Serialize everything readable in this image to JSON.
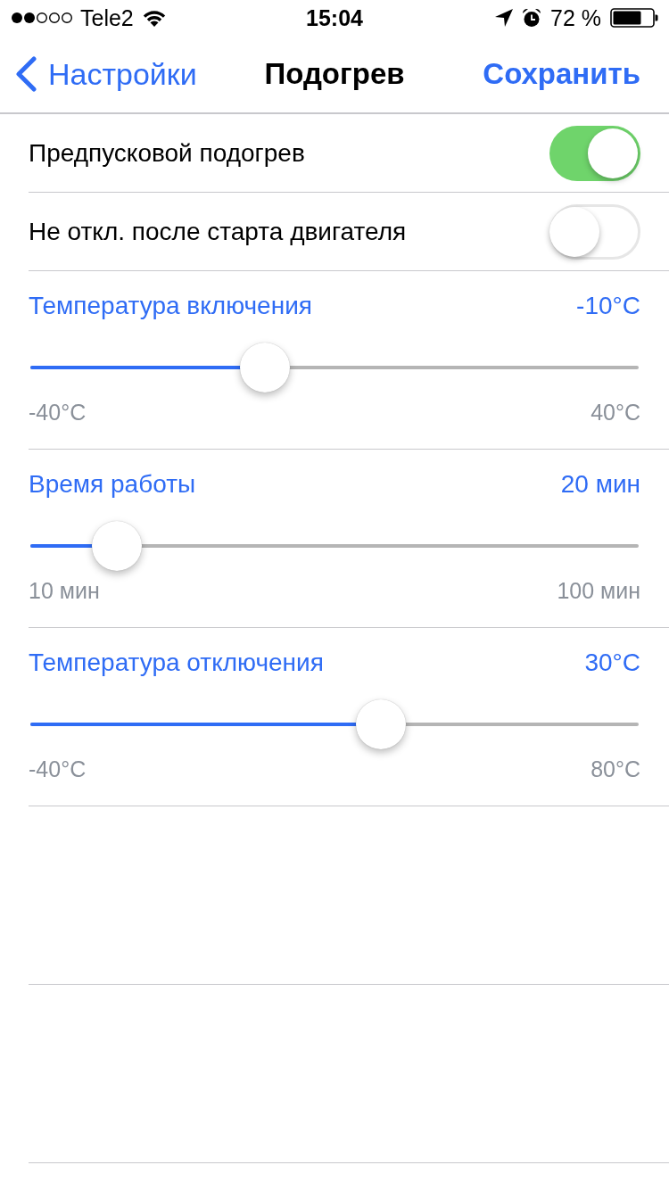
{
  "status_bar": {
    "carrier": "Tele2",
    "time": "15:04",
    "battery": "72 %"
  },
  "nav": {
    "back": "Настройки",
    "title": "Подогрев",
    "action": "Сохранить"
  },
  "toggles": [
    {
      "label": "Предпусковой подогрев",
      "on": true
    },
    {
      "label": "Не откл. после старта двигателя",
      "on": false
    }
  ],
  "sliders": [
    {
      "label": "Температура включения",
      "reading": "-10°C",
      "min": "-40°C",
      "max": "40°C",
      "level": 0.375
    },
    {
      "label": "Время работы",
      "reading": "20 мин",
      "min": "10 мин",
      "max": "100 мин",
      "level": 0.111
    },
    {
      "label": "Температура отключения",
      "reading": "30°C",
      "min": "-40°C",
      "max": "80°C",
      "level": 0.583
    }
  ]
}
